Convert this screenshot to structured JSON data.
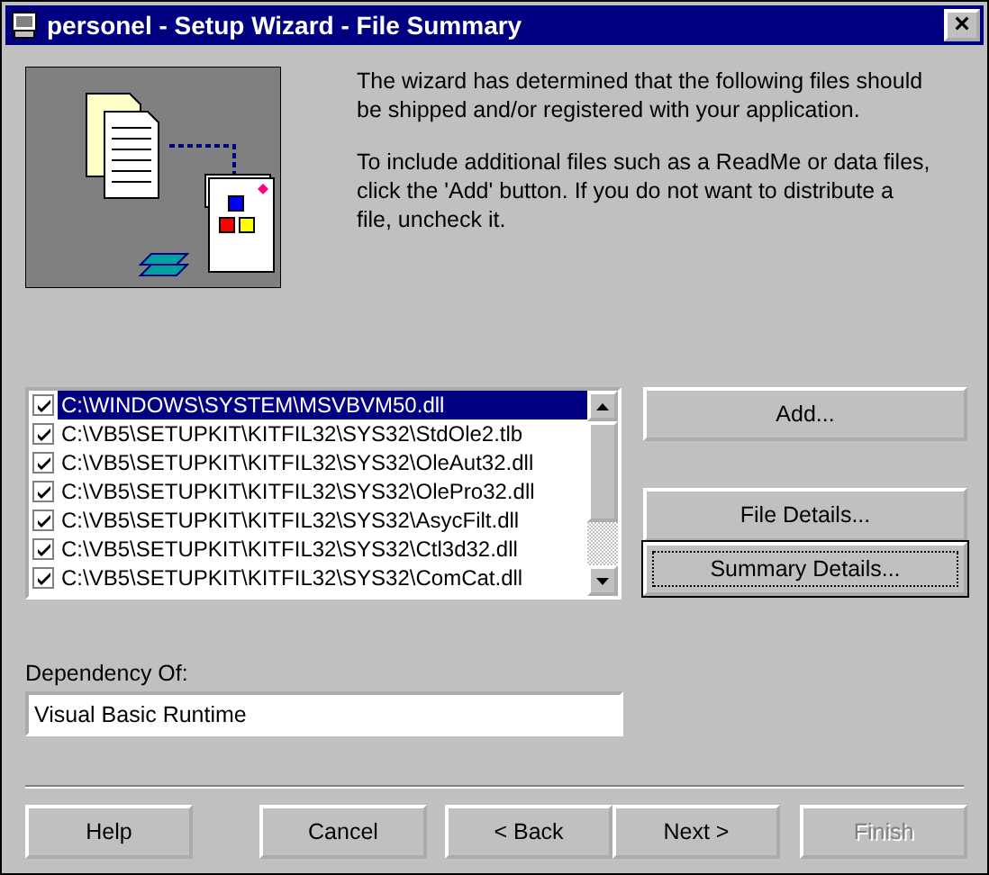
{
  "window": {
    "title": "personel - Setup Wizard - File Summary",
    "close": "×"
  },
  "intro": [
    "The wizard has determined that the following files should be shipped and/or registered with your application.",
    "To include additional files such as a ReadMe or data files, click the 'Add' button.  If you do not want to distribute a file, uncheck it."
  ],
  "files": [
    {
      "path": "C:\\WINDOWS\\SYSTEM\\MSVBVM50.dll",
      "checked": true,
      "selected": true
    },
    {
      "path": "C:\\VB5\\SETUPKIT\\KITFIL32\\SYS32\\StdOle2.tlb",
      "checked": true,
      "selected": false
    },
    {
      "path": "C:\\VB5\\SETUPKIT\\KITFIL32\\SYS32\\OleAut32.dll",
      "checked": true,
      "selected": false
    },
    {
      "path": "C:\\VB5\\SETUPKIT\\KITFIL32\\SYS32\\OlePro32.dll",
      "checked": true,
      "selected": false
    },
    {
      "path": "C:\\VB5\\SETUPKIT\\KITFIL32\\SYS32\\AsycFilt.dll",
      "checked": true,
      "selected": false
    },
    {
      "path": "C:\\VB5\\SETUPKIT\\KITFIL32\\SYS32\\Ctl3d32.dll",
      "checked": true,
      "selected": false
    },
    {
      "path": "C:\\VB5\\SETUPKIT\\KITFIL32\\SYS32\\ComCat.dll",
      "checked": true,
      "selected": false
    }
  ],
  "side_buttons": [
    {
      "label": "Add...",
      "default": false
    },
    {
      "label": "File Details...",
      "default": false
    },
    {
      "label": "Summary Details...",
      "default": true
    }
  ],
  "dependency": {
    "label": "Dependency Of:",
    "value": "Visual Basic Runtime"
  },
  "footer_buttons": [
    {
      "label": "Help",
      "disabled": false
    },
    {
      "label": "Cancel",
      "disabled": false
    },
    {
      "label": "< Back",
      "disabled": false
    },
    {
      "label": "Next >",
      "disabled": false
    },
    {
      "label": "Finish",
      "disabled": true
    }
  ]
}
